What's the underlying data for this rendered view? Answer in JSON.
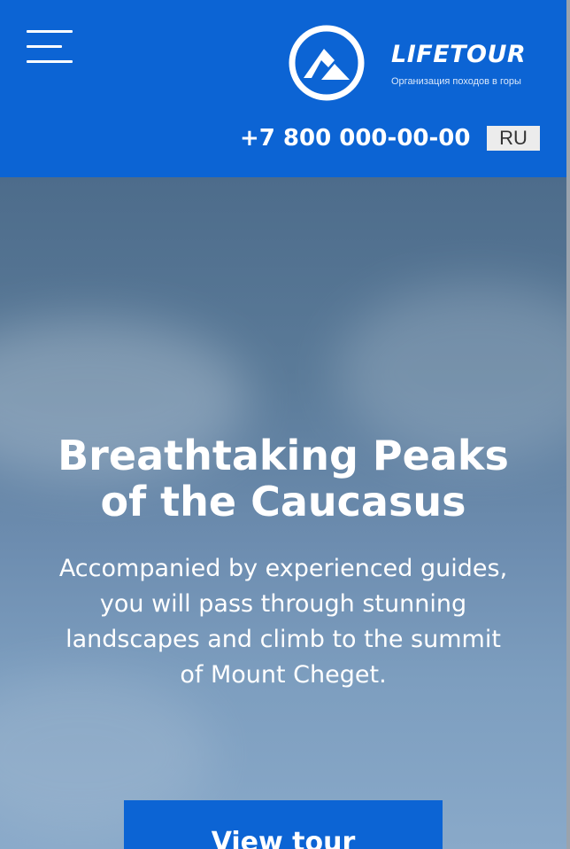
{
  "header": {
    "menu_icon": "hamburger-menu-icon",
    "logo_icon": "mountain-logo-icon",
    "brand_name": "LIFETOUR",
    "brand_tagline": "Организация походов в горы",
    "phone": "+7 800 000-00-00",
    "language": "RU"
  },
  "hero": {
    "title_line1": "Breathtaking Peaks",
    "title_line2": "of the Caucasus",
    "subtitle_line1": "Accompanied by experienced guides,",
    "subtitle_line2": "you will pass through stunning",
    "subtitle_line3": "landscapes and climb to the summit",
    "subtitle_line4": "of Mount Cheget.",
    "cta_label": "View tour"
  },
  "colors": {
    "brand_blue": "#0c64d4",
    "white": "#ffffff",
    "lang_bg": "#ececec"
  }
}
